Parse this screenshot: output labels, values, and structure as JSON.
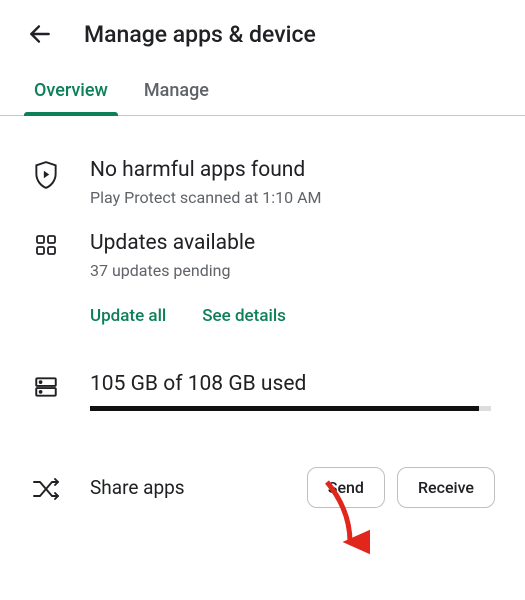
{
  "header": {
    "title": "Manage apps & device"
  },
  "tabs": {
    "overview": "Overview",
    "manage": "Manage"
  },
  "protect": {
    "title": "No harmful apps found",
    "subtitle": "Play Protect scanned at 1:10 AM"
  },
  "updates": {
    "title": "Updates available",
    "subtitle": "37 updates pending",
    "update_all": "Update all",
    "see_details": "See details"
  },
  "storage": {
    "text": "105 GB of 108 GB used",
    "percent": 97
  },
  "share": {
    "title": "Share apps",
    "send": "Send",
    "receive": "Receive"
  }
}
